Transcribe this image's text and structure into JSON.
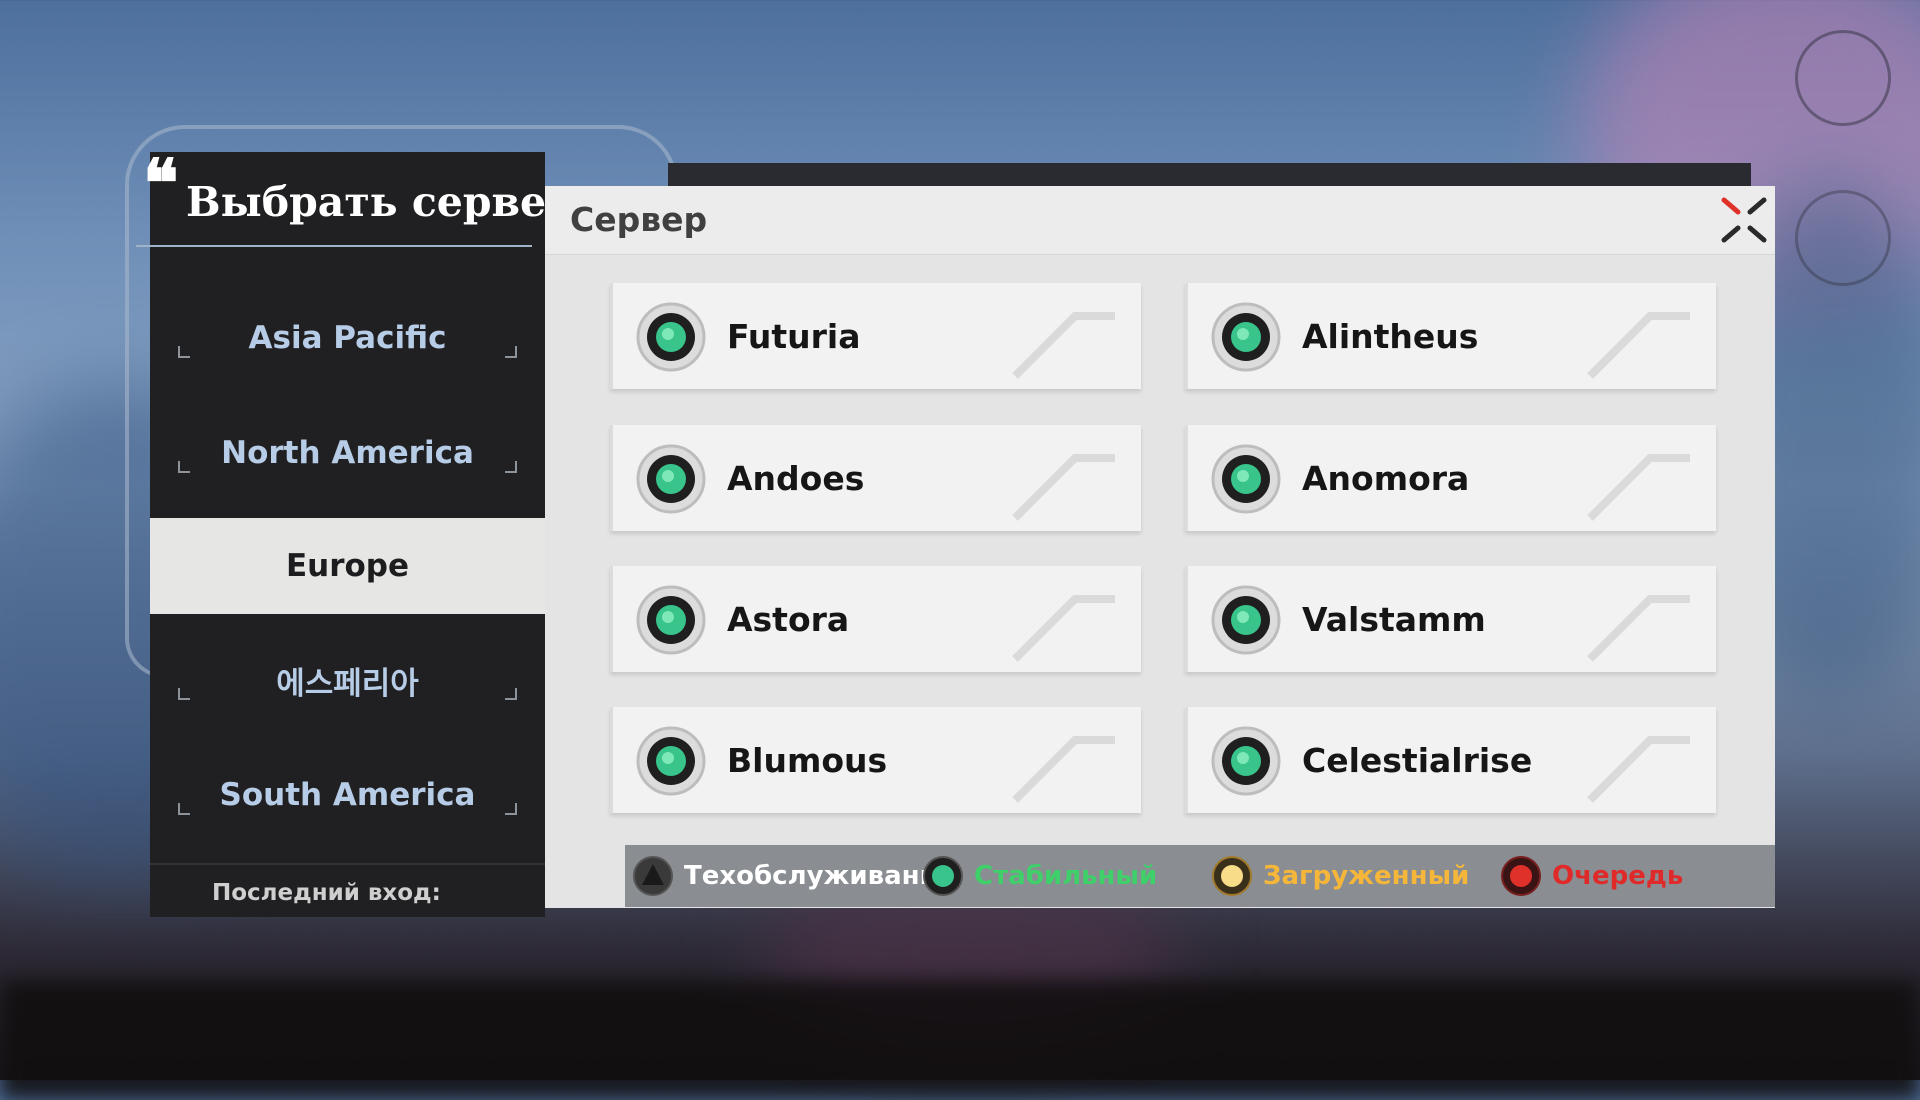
{
  "title": "Выбрать сервер",
  "title_quote": "❝",
  "regions": [
    {
      "label": "Asia Pacific",
      "active": false
    },
    {
      "label": "North America",
      "active": false
    },
    {
      "label": "Europe",
      "active": true
    },
    {
      "label": "에스페리아",
      "active": false
    },
    {
      "label": "South America",
      "active": false
    }
  ],
  "last_login_label": "Последний вход:",
  "server_panel": {
    "title": "Сервер",
    "servers": [
      {
        "name": "Futuria",
        "status": "stable"
      },
      {
        "name": "Alintheus",
        "status": "stable"
      },
      {
        "name": "Andoes",
        "status": "stable"
      },
      {
        "name": "Anomora",
        "status": "stable"
      },
      {
        "name": "Astora",
        "status": "stable"
      },
      {
        "name": "Valstamm",
        "status": "stable"
      },
      {
        "name": "Blumous",
        "status": "stable"
      },
      {
        "name": "Celestialrise",
        "status": "stable"
      }
    ]
  },
  "legend": [
    {
      "label": "Техобслуживание",
      "status": "maintenance",
      "color": "#ffffff"
    },
    {
      "label": "Стабильный",
      "status": "stable",
      "color": "#3fd06a"
    },
    {
      "label": "Загруженный",
      "status": "busy",
      "color": "#f5b63a"
    },
    {
      "label": "Очередь",
      "status": "queue",
      "color": "#e02a2a"
    }
  ],
  "colors": {
    "stable": "#38c48a",
    "busy": "#f5c24a",
    "queue": "#e0302a",
    "maintenance": "#2a2a2a",
    "close_accent": "#e0302a"
  }
}
